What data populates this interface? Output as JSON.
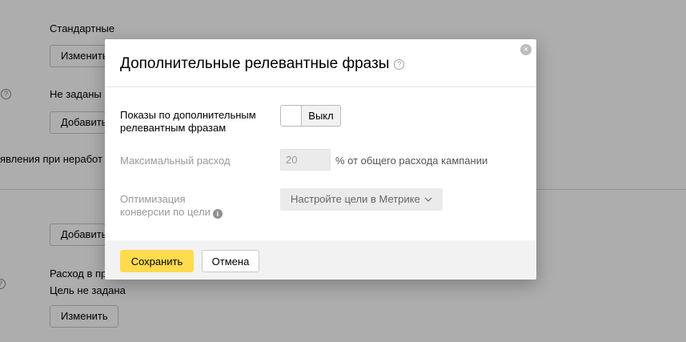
{
  "background": {
    "strategy_value": "Стандартные",
    "change_button_1": "Изменить",
    "not_set_value": "Не заданы",
    "add_button_1": "Добавить",
    "partial_label": "явления при неработ",
    "add_button_2": "Добавить",
    "spend_label_partial": "Расход в пр",
    "goal_not_set": "Цель не задана",
    "change_button_2": "Изменить"
  },
  "dialog": {
    "title": "Дополнительные релевантные фразы",
    "help_icon": "?",
    "close_icon": "×",
    "shows_label": "Показы по дополнительным релевантным фразам",
    "toggle_state": "Выкл",
    "max_spend_label": "Максимальный расход",
    "max_spend_value": "20",
    "max_spend_suffix": "% от общего расхода кампании",
    "optimization_label_line1": "Оптимизация",
    "optimization_label_line2": "конверсии по цели",
    "info_icon": "i",
    "goal_select_value": "Настройте цели в Метрике",
    "save_label": "Сохранить",
    "cancel_label": "Отмена"
  },
  "colors": {
    "accent_button": "#ffdb4d",
    "overlay": "rgba(0,0,0,0.32)",
    "disabled_field": "#ebebeb"
  }
}
